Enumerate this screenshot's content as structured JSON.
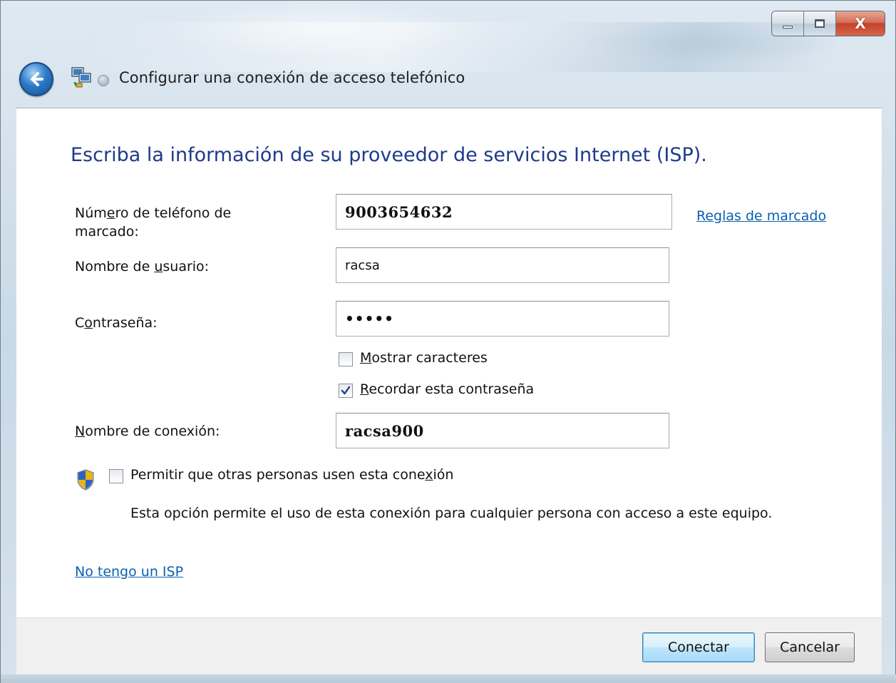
{
  "window": {
    "title": "Configurar una conexión de acceso telefónico",
    "minimize_icon": "minimize-icon",
    "maximize_icon": "maximize-icon",
    "close_icon": "close-icon",
    "close_glyph": "X"
  },
  "navigation": {
    "back_icon": "back-arrow-icon",
    "app_icon": "network-connection-icon"
  },
  "heading": "Escriba la información de su proveedor de servicios Internet (ISP).",
  "form": {
    "phone": {
      "label_pre": "Núm",
      "label_key": "e",
      "label_post": "ro de teléfono de",
      "label_line2": "marcado:",
      "value": "9003654632"
    },
    "dialing_rules_link": "Reglas de marcado",
    "username": {
      "label_pre": "Nombre de ",
      "label_key": "u",
      "label_post": "suario:",
      "value": "racsa"
    },
    "password": {
      "label_pre": "C",
      "label_key": "o",
      "label_post": "ntraseña:",
      "value": "•••••"
    },
    "show_characters": {
      "label_key": "M",
      "label_post": "ostrar caracteres",
      "checked": false
    },
    "remember_password": {
      "label_key": "R",
      "label_post": "ecordar esta contraseña",
      "checked": true
    },
    "connection_name": {
      "label_key": "N",
      "label_post": "ombre de conexión:",
      "value": "racsa900"
    }
  },
  "allow_others": {
    "shield_icon": "uac-shield-icon",
    "label_pre": "Permitir que otras personas usen esta cone",
    "label_key": "x",
    "label_post": "ión",
    "checked": false,
    "description": "Esta opción permite el uso de esta conexión para cualquier persona con acceso a este equipo."
  },
  "no_isp_link": "No tengo un ISP",
  "buttons": {
    "connect": "Conectar",
    "cancel": "Cancelar"
  },
  "colors": {
    "heading": "#1e3a8a",
    "link": "#0b5fb2",
    "close_button": "#c3422a"
  }
}
